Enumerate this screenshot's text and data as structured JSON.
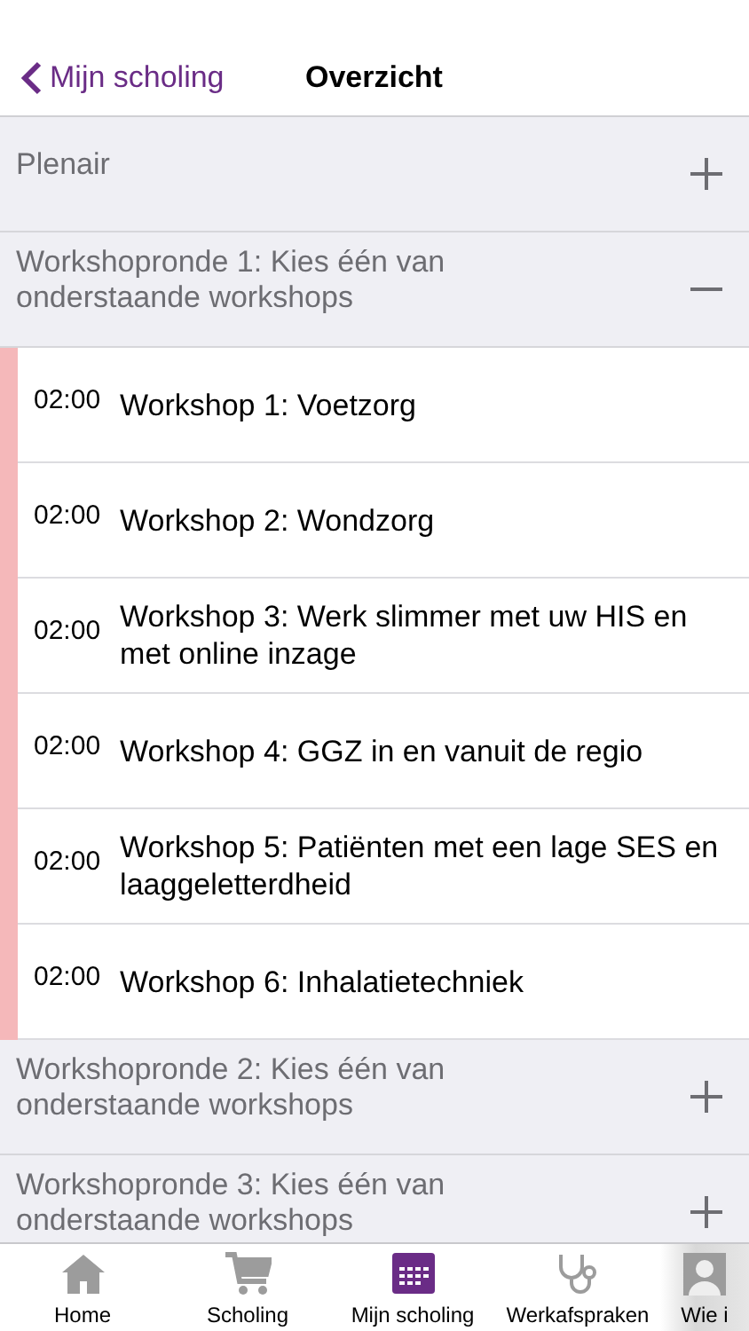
{
  "nav": {
    "back": "Mijn scholing",
    "title": "Overzicht"
  },
  "sections": [
    {
      "title": "Plenair",
      "expanded": false
    },
    {
      "title": "Workshopronde 1: Kies één van onderstaande workshops",
      "expanded": true,
      "workshops": [
        {
          "time": "02:00",
          "title": "Workshop 1: Voetzorg"
        },
        {
          "time": "02:00",
          "title": "Workshop 2: Wondzorg"
        },
        {
          "time": "02:00",
          "title": "Workshop 3: Werk slimmer met uw HIS en met online inzage"
        },
        {
          "time": "02:00",
          "title": "Workshop 4: GGZ in en vanuit de regio"
        },
        {
          "time": "02:00",
          "title": "Workshop 5: Patiënten met een lage SES en laaggeletterdheid"
        },
        {
          "time": "02:00",
          "title": "Workshop 6: Inhalatietechniek"
        }
      ]
    },
    {
      "title": "Workshopronde 2: Kies één van onderstaande workshops",
      "expanded": false
    },
    {
      "title": "Workshopronde 3: Kies één van onderstaande workshops",
      "expanded": false
    }
  ],
  "tabs": [
    {
      "label": "Home",
      "kind": "home",
      "selected": false
    },
    {
      "label": "Scholing",
      "kind": "cart",
      "selected": false
    },
    {
      "label": "Mijn scholing",
      "kind": "calendar",
      "selected": true
    },
    {
      "label": "Werkafspraken",
      "kind": "stethoscope",
      "selected": false
    },
    {
      "label": "Wie i",
      "kind": "person",
      "selected": false
    }
  ]
}
